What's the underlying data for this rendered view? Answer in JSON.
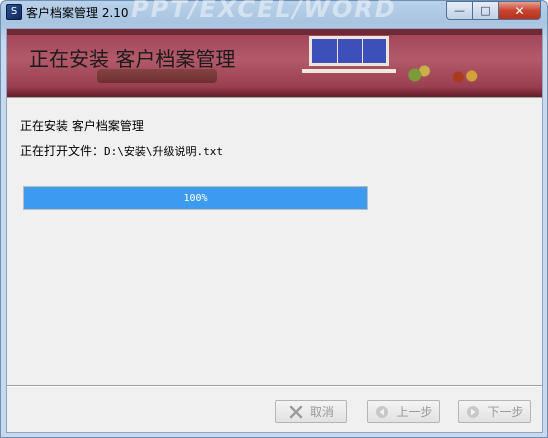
{
  "window": {
    "title": "客户档案管理 2.10",
    "watermark": "PPT/EXCEL/WORD",
    "controls": {
      "minimize": "—",
      "maximize": "□",
      "close": "✕"
    }
  },
  "banner": {
    "title": "正在安装 客户档案管理"
  },
  "status": {
    "line1": "正在安装 客户档案管理",
    "line2_prefix": "正在打开文件：",
    "line2_file": "D:\\安装\\升级说明.txt"
  },
  "progress": {
    "value": 100,
    "label": "100%",
    "color": "#3d9bef"
  },
  "buttons": {
    "cancel": {
      "label": "取消",
      "icon": "close-x-icon",
      "enabled": false
    },
    "prev": {
      "label": "上一步",
      "icon": "arrow-left-icon",
      "enabled": false
    },
    "next": {
      "label": "下一步",
      "icon": "arrow-right-icon",
      "enabled": false
    }
  }
}
